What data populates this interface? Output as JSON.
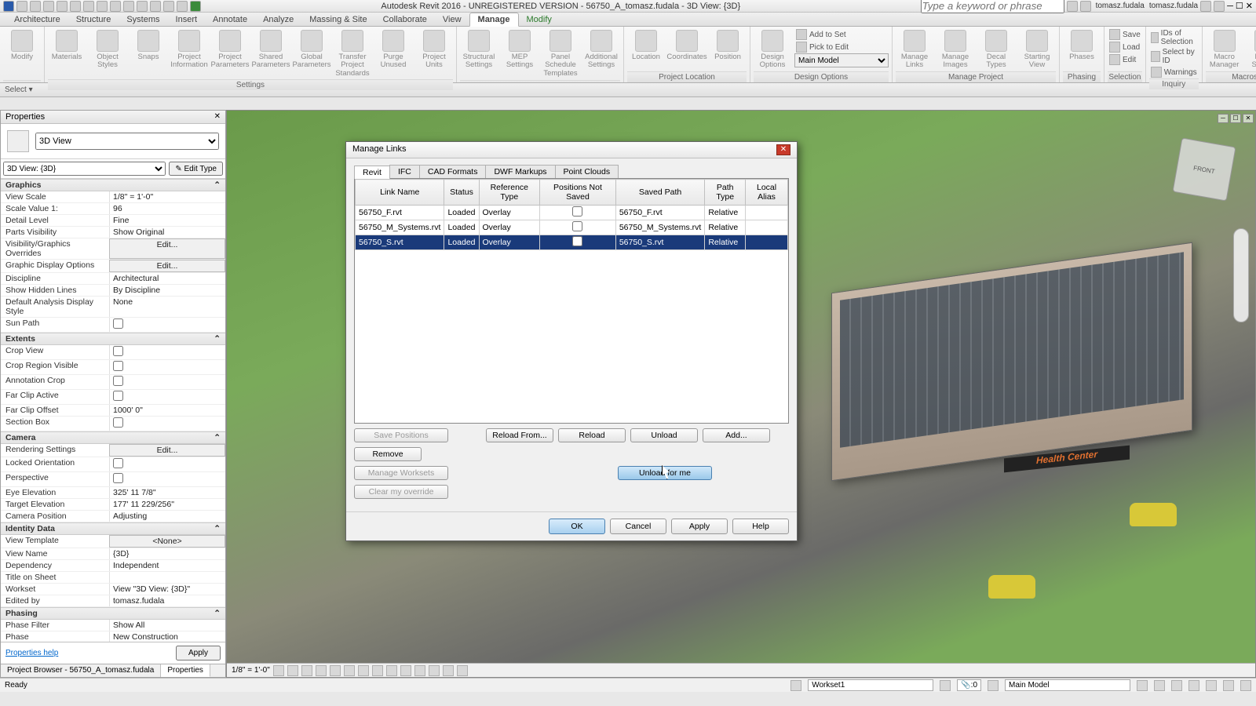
{
  "app": {
    "title": "Autodesk Revit 2016 - UNREGISTERED VERSION -   56750_A_tomasz.fudala - 3D View: {3D}",
    "search_placeholder": "Type a keyword or phrase",
    "user": "tomasz.fudala"
  },
  "ribbon_tabs": [
    "Architecture",
    "Structure",
    "Systems",
    "Insert",
    "Annotate",
    "Analyze",
    "Massing & Site",
    "Collaborate",
    "View",
    "Manage",
    "Modify"
  ],
  "ribbon_active_tab": "Manage",
  "ribbon": {
    "panels": [
      {
        "label": "",
        "buttons": [
          {
            "label": "Modify"
          }
        ]
      },
      {
        "label": "Settings",
        "buttons": [
          {
            "label": "Materials"
          },
          {
            "label": "Object Styles"
          },
          {
            "label": "Snaps"
          },
          {
            "label": "Project Information"
          },
          {
            "label": "Project Parameters"
          },
          {
            "label": "Shared Parameters"
          },
          {
            "label": "Global Parameters"
          },
          {
            "label": "Transfer Project Standards"
          },
          {
            "label": "Purge Unused"
          },
          {
            "label": "Project Units"
          }
        ]
      },
      {
        "label": "",
        "buttons": [
          {
            "label": "Structural Settings"
          },
          {
            "label": "MEP Settings"
          },
          {
            "label": "Panel Schedule Templates"
          },
          {
            "label": "Additional Settings"
          }
        ]
      },
      {
        "label": "Project Location",
        "buttons": [
          {
            "label": "Location"
          },
          {
            "label": "Coordinates"
          },
          {
            "label": "Position"
          }
        ]
      },
      {
        "label": "Design Options",
        "buttons": [
          {
            "label": "Design Options"
          }
        ],
        "small": [
          {
            "label": "Add to Set"
          },
          {
            "label": "Pick to Edit"
          }
        ],
        "combo": "Main Model"
      },
      {
        "label": "Manage Project",
        "buttons": [
          {
            "label": "Manage Links"
          },
          {
            "label": "Manage Images"
          },
          {
            "label": "Decal Types"
          },
          {
            "label": "Starting View"
          }
        ]
      },
      {
        "label": "Phasing",
        "buttons": [
          {
            "label": "Phases"
          }
        ]
      },
      {
        "label": "Selection",
        "small": [
          {
            "label": "Save"
          },
          {
            "label": "Load"
          },
          {
            "label": "Edit"
          }
        ]
      },
      {
        "label": "Inquiry",
        "small": [
          {
            "label": "IDs of Selection"
          },
          {
            "label": "Select by ID"
          },
          {
            "label": "Warnings"
          }
        ]
      },
      {
        "label": "Macros",
        "buttons": [
          {
            "label": "Macro Manager"
          },
          {
            "label": "Macro Security"
          }
        ]
      }
    ]
  },
  "select_bar": "Select ▾",
  "properties": {
    "title": "Properties",
    "type": "3D View",
    "filter": "3D View: {3D}",
    "edit_type": "Edit Type",
    "sections": [
      {
        "name": "Graphics",
        "rows": [
          {
            "k": "View Scale",
            "v": "1/8\" = 1'-0\""
          },
          {
            "k": "Scale Value    1:",
            "v": "96"
          },
          {
            "k": "Detail Level",
            "v": "Fine"
          },
          {
            "k": "Parts Visibility",
            "v": "Show Original"
          },
          {
            "k": "Visibility/Graphics Overrides",
            "v": "Edit...",
            "btn": true
          },
          {
            "k": "Graphic Display Options",
            "v": "Edit...",
            "btn": true
          },
          {
            "k": "Discipline",
            "v": "Architectural"
          },
          {
            "k": "Show Hidden Lines",
            "v": "By Discipline"
          },
          {
            "k": "Default Analysis Display Style",
            "v": "None"
          },
          {
            "k": "Sun Path",
            "v": "",
            "check": false
          }
        ]
      },
      {
        "name": "Extents",
        "rows": [
          {
            "k": "Crop View",
            "v": "",
            "check": false
          },
          {
            "k": "Crop Region Visible",
            "v": "",
            "check": false
          },
          {
            "k": "Annotation Crop",
            "v": "",
            "check": false
          },
          {
            "k": "Far Clip Active",
            "v": "",
            "check": false
          },
          {
            "k": "Far Clip Offset",
            "v": "1000'  0\""
          },
          {
            "k": "Section Box",
            "v": "",
            "check": false
          }
        ]
      },
      {
        "name": "Camera",
        "rows": [
          {
            "k": "Rendering Settings",
            "v": "Edit...",
            "btn": true
          },
          {
            "k": "Locked Orientation",
            "v": "",
            "check": false
          },
          {
            "k": "Perspective",
            "v": "",
            "check": false
          },
          {
            "k": "Eye Elevation",
            "v": "325'  11 7/8\""
          },
          {
            "k": "Target Elevation",
            "v": "177'  11 229/256\""
          },
          {
            "k": "Camera Position",
            "v": "Adjusting"
          }
        ]
      },
      {
        "name": "Identity Data",
        "rows": [
          {
            "k": "View Template",
            "v": "<None>",
            "btn": true
          },
          {
            "k": "View Name",
            "v": "{3D}"
          },
          {
            "k": "Dependency",
            "v": "Independent"
          },
          {
            "k": "Title on Sheet",
            "v": ""
          },
          {
            "k": "Workset",
            "v": "View \"3D View: {3D}\""
          },
          {
            "k": "Edited by",
            "v": "tomasz.fudala"
          }
        ]
      },
      {
        "name": "Phasing",
        "rows": [
          {
            "k": "Phase Filter",
            "v": "Show All"
          },
          {
            "k": "Phase",
            "v": "New Construction"
          }
        ]
      }
    ],
    "help_link": "Properties help",
    "apply": "Apply"
  },
  "bottom_tabs": [
    "Project Browser - 56750_A_tomasz.fudala",
    "Properties"
  ],
  "bottom_tabs_active": 1,
  "dialog": {
    "title": "Manage Links",
    "tabs": [
      "Revit",
      "IFC",
      "CAD Formats",
      "DWF Markups",
      "Point Clouds"
    ],
    "active_tab": 0,
    "columns": [
      "Link Name",
      "Status",
      "Reference Type",
      "Positions Not Saved",
      "Saved Path",
      "Path Type",
      "Local Alias"
    ],
    "rows": [
      {
        "name": "56750_F.rvt",
        "status": "Loaded",
        "ref": "Overlay",
        "pos": false,
        "path": "56750_F.rvt",
        "ptype": "Relative",
        "alias": ""
      },
      {
        "name": "56750_M_Systems.rvt",
        "status": "Loaded",
        "ref": "Overlay",
        "pos": false,
        "path": "56750_M_Systems.rvt",
        "ptype": "Relative",
        "alias": ""
      },
      {
        "name": "56750_S.rvt",
        "status": "Loaded",
        "ref": "Overlay",
        "pos": false,
        "path": "56750_S.rvt",
        "ptype": "Relative",
        "alias": "",
        "selected": true
      }
    ],
    "buttons_row1": [
      "Save Positions",
      "Reload From...",
      "Reload",
      "Unload",
      "Add...",
      "Remove"
    ],
    "buttons_row2": [
      "Manage Worksets",
      "Unload for me",
      "Clear my override"
    ],
    "footer": [
      "OK",
      "Cancel",
      "Apply",
      "Help"
    ]
  },
  "viewport": {
    "sign": "Health Center",
    "view_scale_text": "1/8\" = 1'-0\""
  },
  "status": {
    "ready": "Ready",
    "workset": "Workset1",
    "sel_count": "0",
    "main_model": "Main Model"
  }
}
